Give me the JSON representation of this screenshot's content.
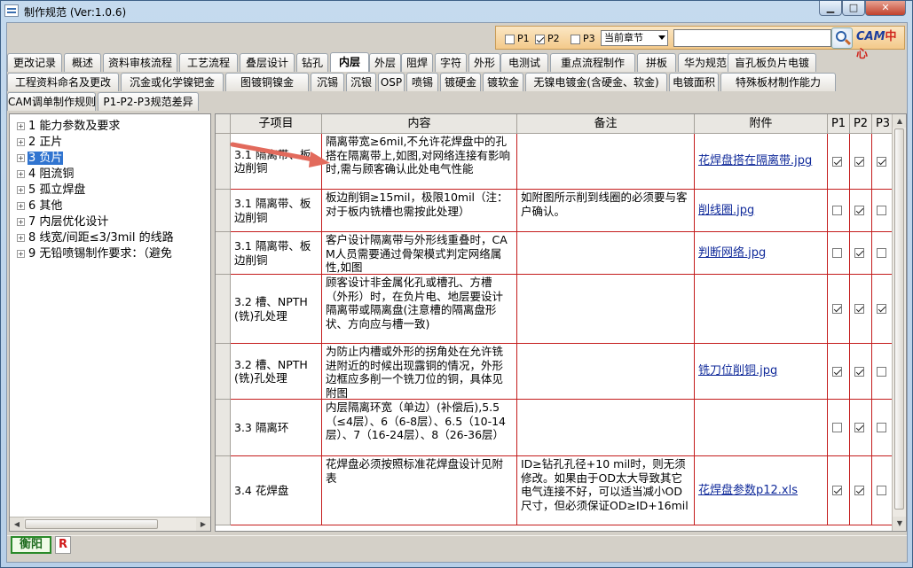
{
  "window": {
    "title": "制作规范 (Ver:1.0.6)",
    "min_label": "▁",
    "max_label": "□",
    "close_label": "✕"
  },
  "filter": {
    "p1_label": "P1",
    "p1_checked": false,
    "p2_label": "P2",
    "p2_checked": true,
    "p3_label": "P3",
    "p3_checked": false,
    "chapter_selected": "当前章节",
    "search_value": "",
    "logo_cam": "CAM",
    "logo_center": "中心"
  },
  "tabs": {
    "row1": [
      "更改记录",
      "概述",
      "资料审核流程",
      "工艺流程",
      "叠层设计",
      "钻孔",
      "内层",
      "外层",
      "阻焊",
      "字符",
      "外形",
      "电测试",
      "重点流程制作",
      "拼板",
      "华为规范",
      "盲孔板负片电镀"
    ],
    "row2": [
      "工程资料命名及更改",
      "沉金或化学镍钯金",
      "图镀铜镍金",
      "沉锡",
      "沉银",
      "OSP",
      "喷锡",
      "镀硬金",
      "镀软金",
      "无镍电镀金(含硬金、软金)",
      "电镀面积",
      "特殊板材制作能力"
    ],
    "row3": [
      "CAM调单制作规则",
      "P1-P2-P3规范差异"
    ],
    "active": "内层"
  },
  "tree": {
    "selected_index": 2,
    "items": [
      "1  能力参数及要求",
      "2  正片",
      "3  负片",
      "4  阻流铜",
      "5  孤立焊盘",
      "6  其他",
      "7  内层优化设计",
      "8  线宽/间距≤3/3mil 的线路",
      "9  无铅喷锡制作要求：（避免"
    ]
  },
  "table": {
    "headers": [
      "子项目",
      "内容",
      "备注",
      "附件",
      "P1",
      "P2",
      "P3"
    ],
    "rows": [
      {
        "sub": "3.1 隔离带、板边削铜",
        "content": "隔离带宽≥6mil,不允许花焊盘中的孔搭在隔离带上,如图,对网络连接有影响时,需与顾客确认此处电气性能",
        "note": "",
        "attach": "花焊盘搭在隔离带.jpg",
        "p1": true,
        "p2": true,
        "p3": true
      },
      {
        "sub": "3.1 隔离带、板边削铜",
        "content": "板边削铜≥15mil，极限10mil（注：对于板内铣槽也需按此处理）",
        "note": "如附图所示削到线圈的必须要与客户确认。",
        "attach": "削线圈.jpg",
        "p1": false,
        "p2": true,
        "p3": false
      },
      {
        "sub": "3.1 隔离带、板边削铜",
        "content": "客户设计隔离带与外形线重叠时，CAM人员需要通过骨架模式判定网络属性,如图",
        "note": "",
        "attach": "判断网络.jpg",
        "p1": false,
        "p2": true,
        "p3": false
      },
      {
        "sub": "3.2 槽、NPTH(铣)孔处理",
        "content": "顾客设计非金属化孔或槽孔、方槽（外形）时，在负片电、地层要设计隔离带或隔离盘(注意槽的隔离盘形状、方向应与槽一致)",
        "note": "",
        "attach": "",
        "p1": true,
        "p2": true,
        "p3": true
      },
      {
        "sub": "3.2 槽、NPTH(铣)孔处理",
        "content": "为防止内槽或外形的拐角处在允许铣进附近的时候出现露铜的情况，外形边框应多削一个铣刀位的铜，具体见附图",
        "note": "",
        "attach": "铣刀位削铜.jpg",
        "p1": true,
        "p2": true,
        "p3": false
      },
      {
        "sub": "3.3 隔离环",
        "content": "内层隔离环宽（单边）(补偿后),5.5（≤4层）、6（6-8层）、6.5（10-14层）、7（16-24层）、8（26-36层）",
        "note": "",
        "attach": "",
        "p1": false,
        "p2": true,
        "p3": false
      },
      {
        "sub": "3.4 花焊盘",
        "content": "花焊盘必须按照标准花焊盘设计见附表",
        "note": "ID≥钻孔孔径+10 mil时，则无须修改。如果由于OD太大导致其它电气连接不好，可以适当减小OD尺寸，但必须保证OD≥ID+16mil",
        "attach": "花焊盘参数p12.xls",
        "p1": true,
        "p2": true,
        "p3": false
      }
    ]
  },
  "status": {
    "city": "衡阳",
    "r_label": "R"
  }
}
